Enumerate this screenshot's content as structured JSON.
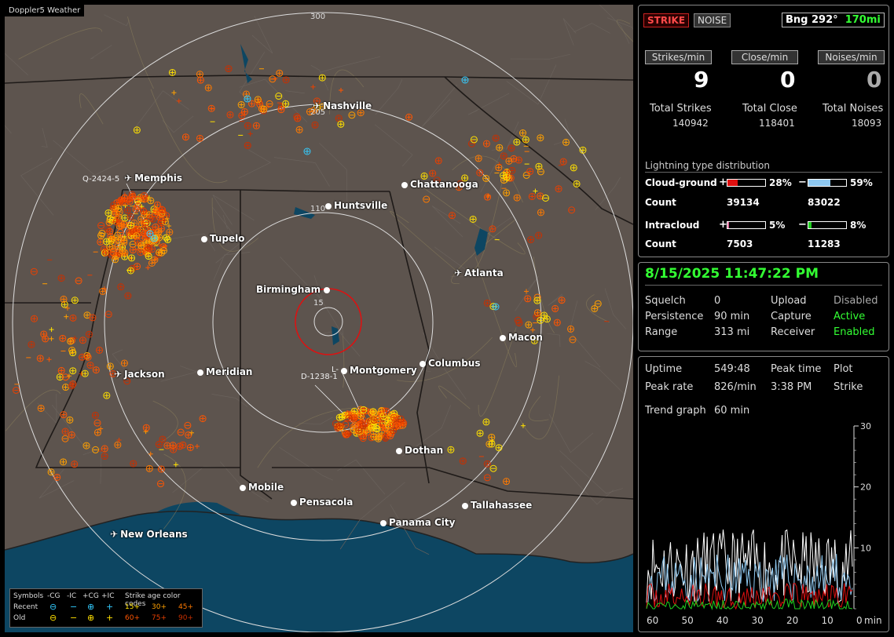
{
  "app": {
    "title": "Doppler5 Weather"
  },
  "map": {
    "range_labels": [
      "300",
      "205",
      "110",
      "15"
    ],
    "cities": [
      {
        "name": "Nashville",
        "icon": "airport-icon"
      },
      {
        "name": "Memphis",
        "icon": "airport-icon"
      },
      {
        "name": "Chattanooga",
        "icon": "city-dot"
      },
      {
        "name": "Huntsville",
        "icon": "city-dot"
      },
      {
        "name": "Tupelo",
        "icon": "city-dot"
      },
      {
        "name": "Atlanta",
        "icon": "airport-icon"
      },
      {
        "name": "Birmingham",
        "icon": "city-dot"
      },
      {
        "name": "Macon",
        "icon": "city-dot"
      },
      {
        "name": "Jackson",
        "icon": "airport-icon"
      },
      {
        "name": "Meridian",
        "icon": "city-dot"
      },
      {
        "name": "Montgomery",
        "icon": "city-dot"
      },
      {
        "name": "Columbus",
        "icon": "city-dot"
      },
      {
        "name": "Dothan",
        "icon": "city-dot"
      },
      {
        "name": "Mobile",
        "icon": "city-dot"
      },
      {
        "name": "Pensacola",
        "icon": "city-dot"
      },
      {
        "name": "Tallahassee",
        "icon": "city-dot"
      },
      {
        "name": "Panama City",
        "icon": "city-dot"
      },
      {
        "name": "New Orleans",
        "icon": "airport-icon"
      }
    ],
    "storm_markers": [
      {
        "label": "Q-2424-5"
      },
      {
        "label": "D-1238-1"
      },
      {
        "label": "L-"
      }
    ],
    "legend": {
      "symbols_label": "Symbols",
      "headers": [
        "-CG",
        "-IC",
        "+CG",
        "+IC"
      ],
      "recent_label": "Recent",
      "old_label": "Old",
      "age_title": "Strike age color codes",
      "recent_ages": [
        "15+",
        "30+",
        "45+"
      ],
      "old_ages": [
        "60+",
        "75+",
        "90+"
      ],
      "recent_symbols": [
        "⊖",
        "−",
        "⊕",
        "+"
      ],
      "old_symbols": [
        "⊖",
        "−",
        "⊕",
        "+"
      ],
      "age_colors": [
        "#ffe000",
        "#ffa000",
        "#ff7a00",
        "#ff5500",
        "#e84000",
        "#c83000"
      ]
    }
  },
  "panel_top": {
    "strike_button": "STRIKE",
    "noise_button": "NOISE",
    "bearing": "Bng 292°",
    "bearing_range": "170mi",
    "rate_labels": [
      "Strikes/min",
      "Close/min",
      "Noises/min"
    ],
    "rate_values": [
      "9",
      "0",
      "0"
    ],
    "total_labels": [
      "Total Strikes",
      "Total Close",
      "Total Noises"
    ],
    "total_values": [
      "140942",
      "118401",
      "18093"
    ],
    "distribution_title": "Lightning type distribution",
    "cg_label": "Cloud-ground",
    "cg_pos_pct": "28%",
    "cg_neg_pct": "59%",
    "cg_pos_fraction": 0.28,
    "cg_neg_fraction": 0.59,
    "count_label": "Count",
    "cg_pos_count": "39134",
    "cg_neg_count": "83022",
    "ic_label": "Intracloud",
    "ic_pos_pct": "5%",
    "ic_neg_pct": "8%",
    "ic_pos_fraction": 0.05,
    "ic_neg_fraction": 0.08,
    "ic_pos_count": "7503",
    "ic_neg_count": "11283",
    "plus": "+",
    "minus": "−",
    "colors": {
      "cg_pos": "#e01010",
      "cg_neg": "#8ec8f0",
      "ic_pos": "#e070a0",
      "ic_neg": "#20d020"
    }
  },
  "panel_status": {
    "datetime": "8/15/2025 11:47:22 PM",
    "rows": [
      {
        "k1": "Squelch",
        "v1": "0",
        "k2": "Upload",
        "v2": "Disabled"
      },
      {
        "k1": "Persistence",
        "v1": "90 min",
        "k2": "Capture",
        "v2": "Active"
      },
      {
        "k1": "Range",
        "v1": "313 mi",
        "k2": "Receiver",
        "v2": "Enabled"
      }
    ]
  },
  "panel_trend": {
    "uptime_label": "Uptime",
    "uptime": "549:48",
    "peak_time_label": "Peak time",
    "peak_time": "3:38 PM",
    "plot_label": "Plot",
    "peak_rate_label": "Peak rate",
    "peak_rate": "826/min",
    "plot_value": "Strike",
    "trend_label": "Trend graph",
    "trend_value": "60 min",
    "y_ticks": [
      "30",
      "20",
      "10"
    ],
    "x_ticks": [
      "60",
      "50",
      "40",
      "30",
      "20",
      "10",
      "0"
    ],
    "x_unit": "min"
  }
}
